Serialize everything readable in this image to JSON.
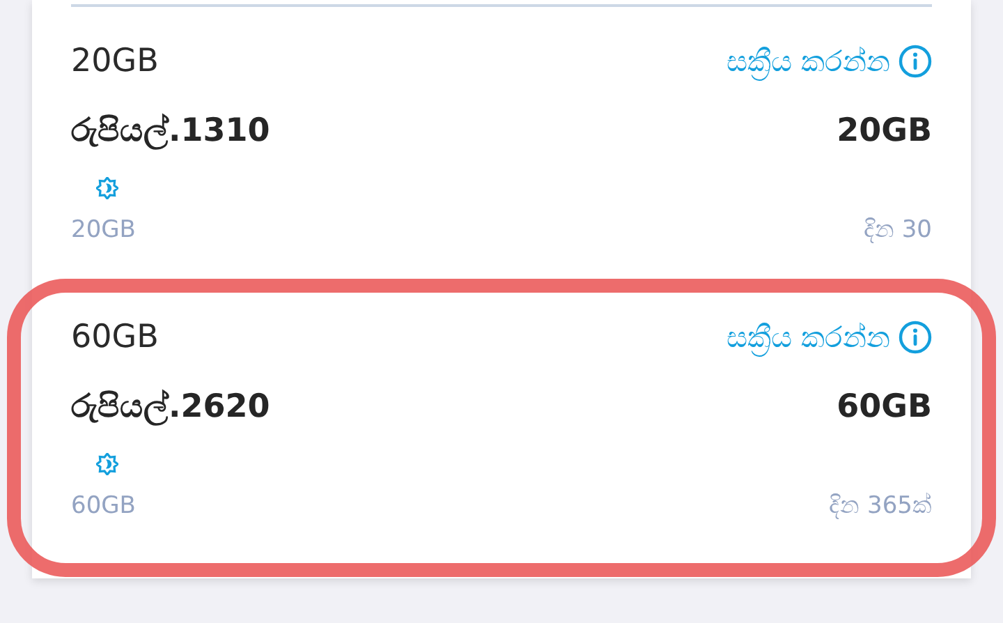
{
  "plans": [
    {
      "name": "20GB",
      "action": "සක්‍රීය කරන්න",
      "price": "රුපියල්.1310",
      "data": "20GB",
      "data_note": "20GB",
      "validity": "දින 30",
      "highlighted": false
    },
    {
      "name": "60GB",
      "action": "සක්‍රීය කරන්න",
      "price": "රුපියල්.2620",
      "data": "60GB",
      "data_note": "60GB",
      "validity": "දින 365ක්",
      "highlighted": true
    }
  ]
}
